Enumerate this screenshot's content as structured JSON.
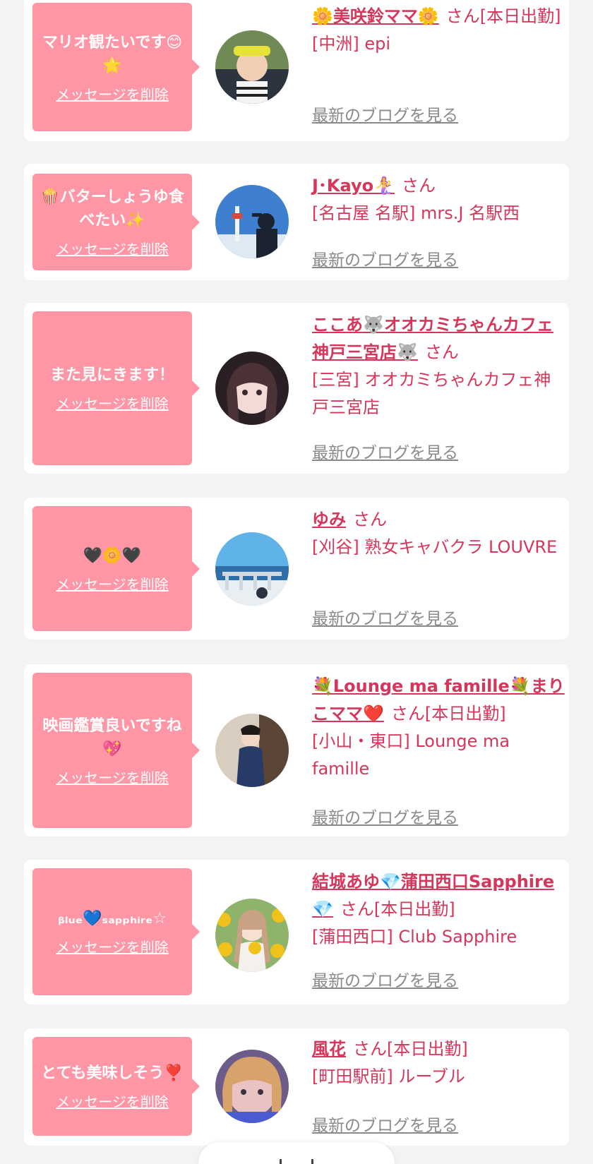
{
  "delete_label": "メッセージを削除",
  "blog_label": "最新のブログを見る",
  "san": "さん",
  "colors": {
    "bubble": "#ff96a6",
    "accent": "#d6365a",
    "link_gray": "#8a8a8a",
    "background": "#f3f3f3"
  },
  "messages": [
    {
      "message": "マリオ観たいです😊🌟",
      "name": "🌼美咲鈴ママ🌼",
      "status": "[本日出勤]",
      "shop": "[中洲] epi"
    },
    {
      "message": "🍿バターしょうゆ食べたい✨",
      "name": "J･Kayo🧜‍♀️",
      "status": "",
      "shop": "[名古屋 名駅] mrs.J 名駅西"
    },
    {
      "message": "また見にきます！",
      "name": "ここあ🐺オオカミちゃんカフェ神戸三宮店🐺",
      "status": "",
      "shop": "[三宮] オオカミちゃんカフェ神戸三宮店"
    },
    {
      "message": "🖤🌼🖤",
      "name": "ゆみ",
      "status": "",
      "shop": "[刈谷] 熟女キャバクラ LOUVRE"
    },
    {
      "message": "映画鑑賞良いですね💖",
      "name": "💐Lounge ma famille💐まりこママ❤️",
      "status": "[本日出勤]",
      "shop": "[小山・東口] Lounge ma famille"
    },
    {
      "message": "ᵦₗᵤₑ💙ₛₐₚₚₕᵢᵣₑ☆",
      "name": "結城あゆ💎蒲田西口Sapphire💎",
      "status": "[本日出勤]",
      "shop": "[蒲田西口] Club Sapphire"
    },
    {
      "message": "とても美味しそう❣️",
      "name": "風花",
      "status": "[本日出勤]",
      "shop": "[町田駅前] ルーブル"
    }
  ]
}
